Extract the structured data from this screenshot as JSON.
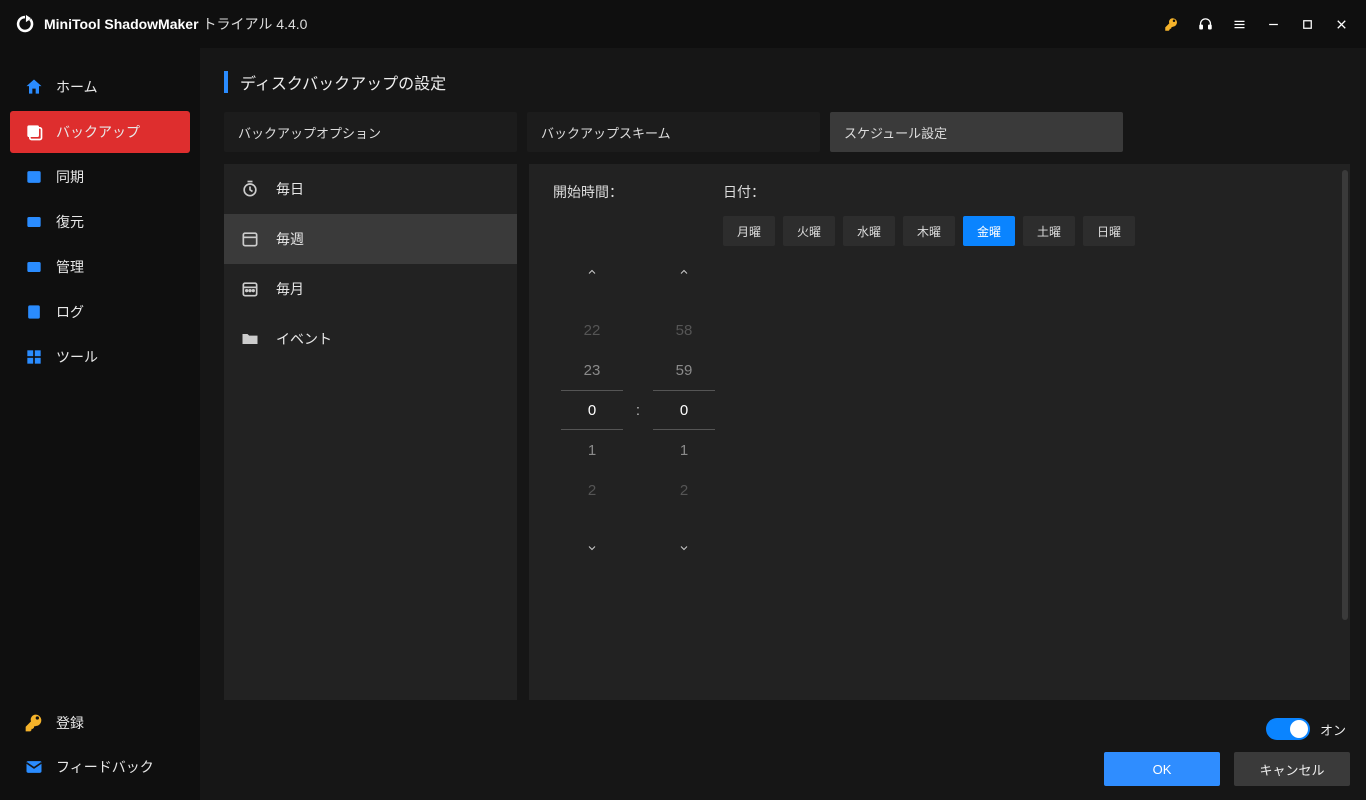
{
  "app": {
    "title_bold": "MiniTool ShadowMaker",
    "title_rest": "トライアル 4.4.0"
  },
  "sidebar": {
    "items": [
      {
        "label": "ホーム"
      },
      {
        "label": "バックアップ"
      },
      {
        "label": "同期"
      },
      {
        "label": "復元"
      },
      {
        "label": "管理"
      },
      {
        "label": "ログ"
      },
      {
        "label": "ツール"
      }
    ],
    "bottom": [
      {
        "label": "登録"
      },
      {
        "label": "フィードバック"
      }
    ]
  },
  "page": {
    "title": "ディスクバックアップの設定"
  },
  "tabs": [
    {
      "label": "バックアップオプション"
    },
    {
      "label": "バックアップスキーム"
    },
    {
      "label": "スケジュール設定"
    }
  ],
  "freq": [
    {
      "label": "毎日"
    },
    {
      "label": "毎週"
    },
    {
      "label": "毎月"
    },
    {
      "label": "イベント"
    }
  ],
  "detail": {
    "start_label": "開始時間：",
    "date_label": "日付：",
    "days": [
      {
        "label": "月曜"
      },
      {
        "label": "火曜"
      },
      {
        "label": "水曜"
      },
      {
        "label": "木曜"
      },
      {
        "label": "金曜"
      },
      {
        "label": "土曜"
      },
      {
        "label": "日曜"
      }
    ],
    "hours": [
      "22",
      "23",
      "0",
      "1",
      "2"
    ],
    "minutes": [
      "58",
      "59",
      "0",
      "1",
      "2"
    ],
    "colon": ":"
  },
  "footer": {
    "toggle_label": "オン",
    "ok": "OK",
    "cancel": "キャンセル"
  }
}
